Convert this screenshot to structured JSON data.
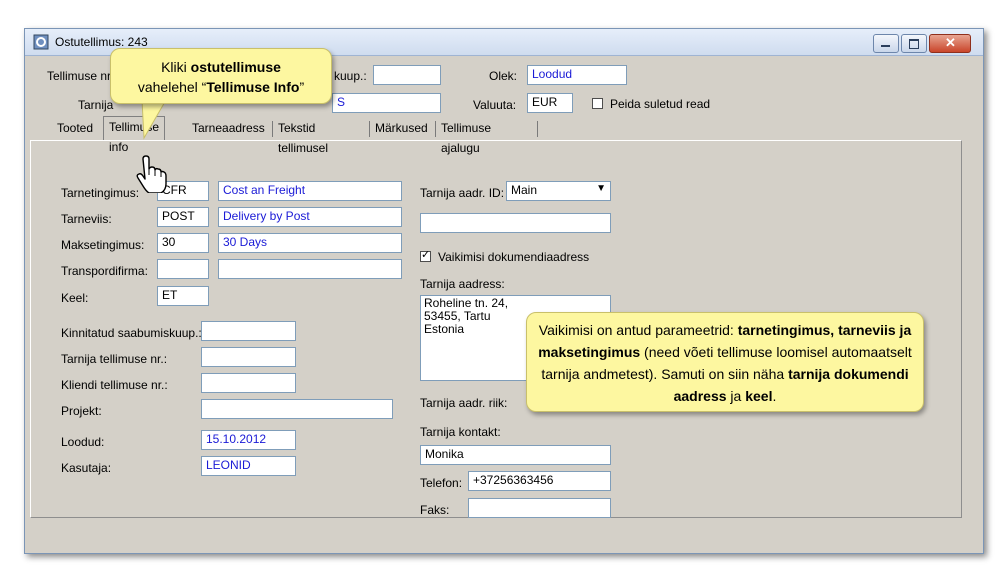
{
  "window": {
    "title": "Ostutellimus: 243"
  },
  "header": {
    "order_nr_label": "Tellimuse nr.",
    "arrival_label": "kuup.:",
    "arrival_value": "",
    "supplier_label": "Tarnija",
    "supplier_value": "S",
    "status_label": "Olek:",
    "status_value": "Loodud",
    "currency_label": "Valuuta:",
    "currency_value": "EUR",
    "hide_closed_label": "Peida suletud read"
  },
  "tabs": [
    "Tooted",
    "Tellimuse info",
    "Tarneaadress",
    "Tekstid tellimusel",
    "Märkused",
    "Tellimuse ajalugu"
  ],
  "left": {
    "delivery_terms": {
      "label": "Tarnetingimus:",
      "code": "CFR",
      "desc": "Cost an Freight"
    },
    "delivery_method": {
      "label": "Tarneviis:",
      "code": "POST",
      "desc": "Delivery by Post"
    },
    "payment_terms": {
      "label": "Maksetingimus:",
      "code": "30",
      "desc": "30 Days"
    },
    "transport": {
      "label": "Transpordifirma:",
      "code": "",
      "desc": ""
    },
    "language": {
      "label": "Keel:",
      "code": "ET"
    },
    "confirmed_arrival": {
      "label": "Kinnitatud saabumiskuup.:",
      "value": ""
    },
    "supplier_order_nr": {
      "label": "Tarnija tellimuse nr.:",
      "value": ""
    },
    "client_order_nr": {
      "label": "Kliendi tellimuse nr.:",
      "value": ""
    },
    "project": {
      "label": "Projekt:",
      "value": ""
    },
    "created": {
      "label": "Loodud:",
      "value": "15.10.2012"
    },
    "user": {
      "label": "Kasutaja:",
      "value": "LEONID"
    }
  },
  "right": {
    "addr_id": {
      "label": "Tarnija aadr. ID:",
      "value": "Main"
    },
    "addr_extra": "",
    "default_doc_addr": {
      "label": "Vaikimisi dokumendiaadress",
      "checked": true
    },
    "supplier_address": {
      "label": "Tarnija aadress:",
      "lines": [
        "Roheline tn. 24,",
        "53455, Tartu",
        "Estonia"
      ]
    },
    "addr_country": {
      "label": "Tarnija aadr. riik:"
    },
    "contact": {
      "label": "Tarnija kontakt:",
      "value": "Monika"
    },
    "phone": {
      "label": "Telefon:",
      "value": "+37256363456"
    },
    "fax": {
      "label": "Faks:",
      "value": ""
    }
  },
  "callouts": {
    "first": {
      "pre": "Kliki ",
      "bold1": "ostutellimuse",
      "mid": "vahelehel “",
      "bold2": "Tellimuse Info",
      "post": "”"
    },
    "second": {
      "p1": "Vaikimisi on antud parameetrid: ",
      "b1": "tarnetingimus,",
      "b2": "tarneviis ja maksetingimus",
      "p2": " (need võeti tellimuse loomisel automaatselt tarnija andmetest). Samuti on siin näha ",
      "b3": "tarnija dokumendi aadress",
      "p3": " ja ",
      "b4": "keel",
      "p4": "."
    }
  }
}
